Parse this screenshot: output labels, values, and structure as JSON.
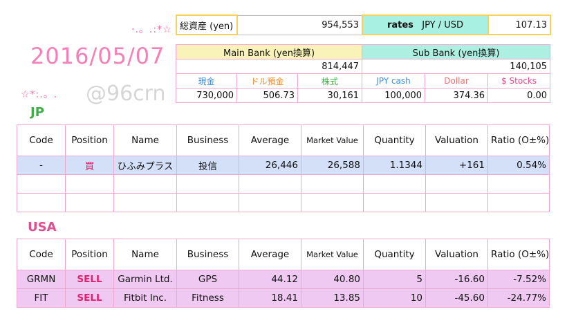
{
  "header": {
    "deco_left": "·.。.:*☆",
    "deco_right": "☆*:.。.",
    "date": "2016/05/07",
    "watermark": "@96crn"
  },
  "summary": {
    "total_label": "総資産 (yen)",
    "total_value": "954,553",
    "rates_label": "rates",
    "pair": "JPY / USD",
    "rate_value": "107.13"
  },
  "bank": {
    "main_header": "Main Bank (yen換算)",
    "sub_header": "Sub Bank (yen換算)",
    "main_total": "814,447",
    "sub_total": "140,105",
    "labels": [
      "現金",
      "ドル預金",
      "株式",
      "JPY cash",
      "Dollar",
      "$ Stocks"
    ],
    "label_colors": [
      "#3a8ee0",
      "#f08a2a",
      "#3fae48",
      "#3a8ee0",
      "#f06f6f",
      "#e24d8e"
    ],
    "values": [
      "730,000",
      "506.73",
      "30,161",
      "100,000",
      "374.36",
      "0.00"
    ]
  },
  "sections": {
    "jp": "JP",
    "usa": "USA"
  },
  "columns": [
    "Code",
    "Position",
    "Name",
    "Business",
    "Average",
    "Market Value",
    "Quantity",
    "Valuation",
    "Ratio (O±%)"
  ],
  "jp_rows": [
    [
      "-",
      "買",
      "ひふみプラス",
      "投信",
      "26,446",
      "26,588",
      "1.1344",
      "+161",
      "0.54%"
    ]
  ],
  "usa_rows": [
    [
      "GRMN",
      "SELL",
      "Garmin Ltd.",
      "GPS",
      "44.12",
      "40.80",
      "5",
      "-16.60",
      "-7.52%"
    ],
    [
      "FIT",
      "SELL",
      "Fitbit Inc.",
      "Fitness",
      "18.41",
      "13.85",
      "10",
      "-45.60",
      "-24.77%"
    ]
  ]
}
